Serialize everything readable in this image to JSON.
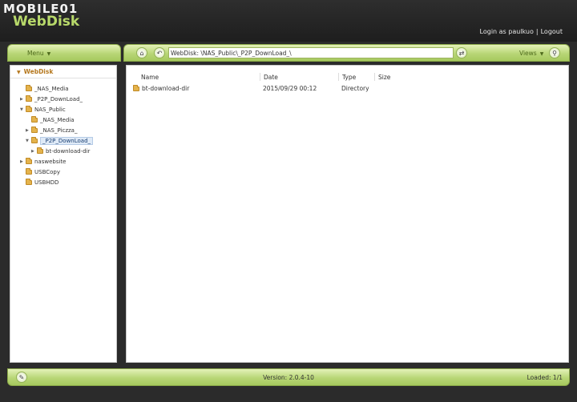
{
  "header": {
    "logo_top": "MOBILE01",
    "logo_main": "WebDisk",
    "login_text": "Login as paulkuo",
    "separator": "|",
    "logout": "Logout"
  },
  "menubar": {
    "menu_label": "Menu"
  },
  "toolbar": {
    "path": "WebDisk: \\NAS_Public\\_P2P_DownLoad_\\",
    "views_label": "Views"
  },
  "tree": {
    "root": "WebDisk",
    "items": [
      {
        "label": "_NAS_Media"
      },
      {
        "label": "_P2P_DownLoad_"
      },
      {
        "label": "NAS_Public"
      },
      {
        "label": "_NAS_Media"
      },
      {
        "label": "_NAS_Piczza_"
      },
      {
        "label": "_P2P_DownLoad_"
      },
      {
        "label": "bt-download-dir"
      },
      {
        "label": "naswebsite"
      },
      {
        "label": "USBCopy"
      },
      {
        "label": "USBHDD"
      }
    ]
  },
  "files": {
    "columns": [
      "Name",
      "Date",
      "Type",
      "Size"
    ],
    "rows": [
      {
        "name": "bt-download-dir",
        "date": "2015/09/29 00:12",
        "type": "Directory",
        "size": ""
      }
    ]
  },
  "status": {
    "version": "Version: 2.0.4-10",
    "loaded": "Loaded: 1/1"
  },
  "colors": {
    "accent_green": "#b8d676",
    "tree_root": "#b5781e",
    "folder": "#e4b34c"
  },
  "icons": [
    "home-icon",
    "back-icon",
    "refresh-icon",
    "search-icon",
    "wrench-icon",
    "folder-icon"
  ]
}
